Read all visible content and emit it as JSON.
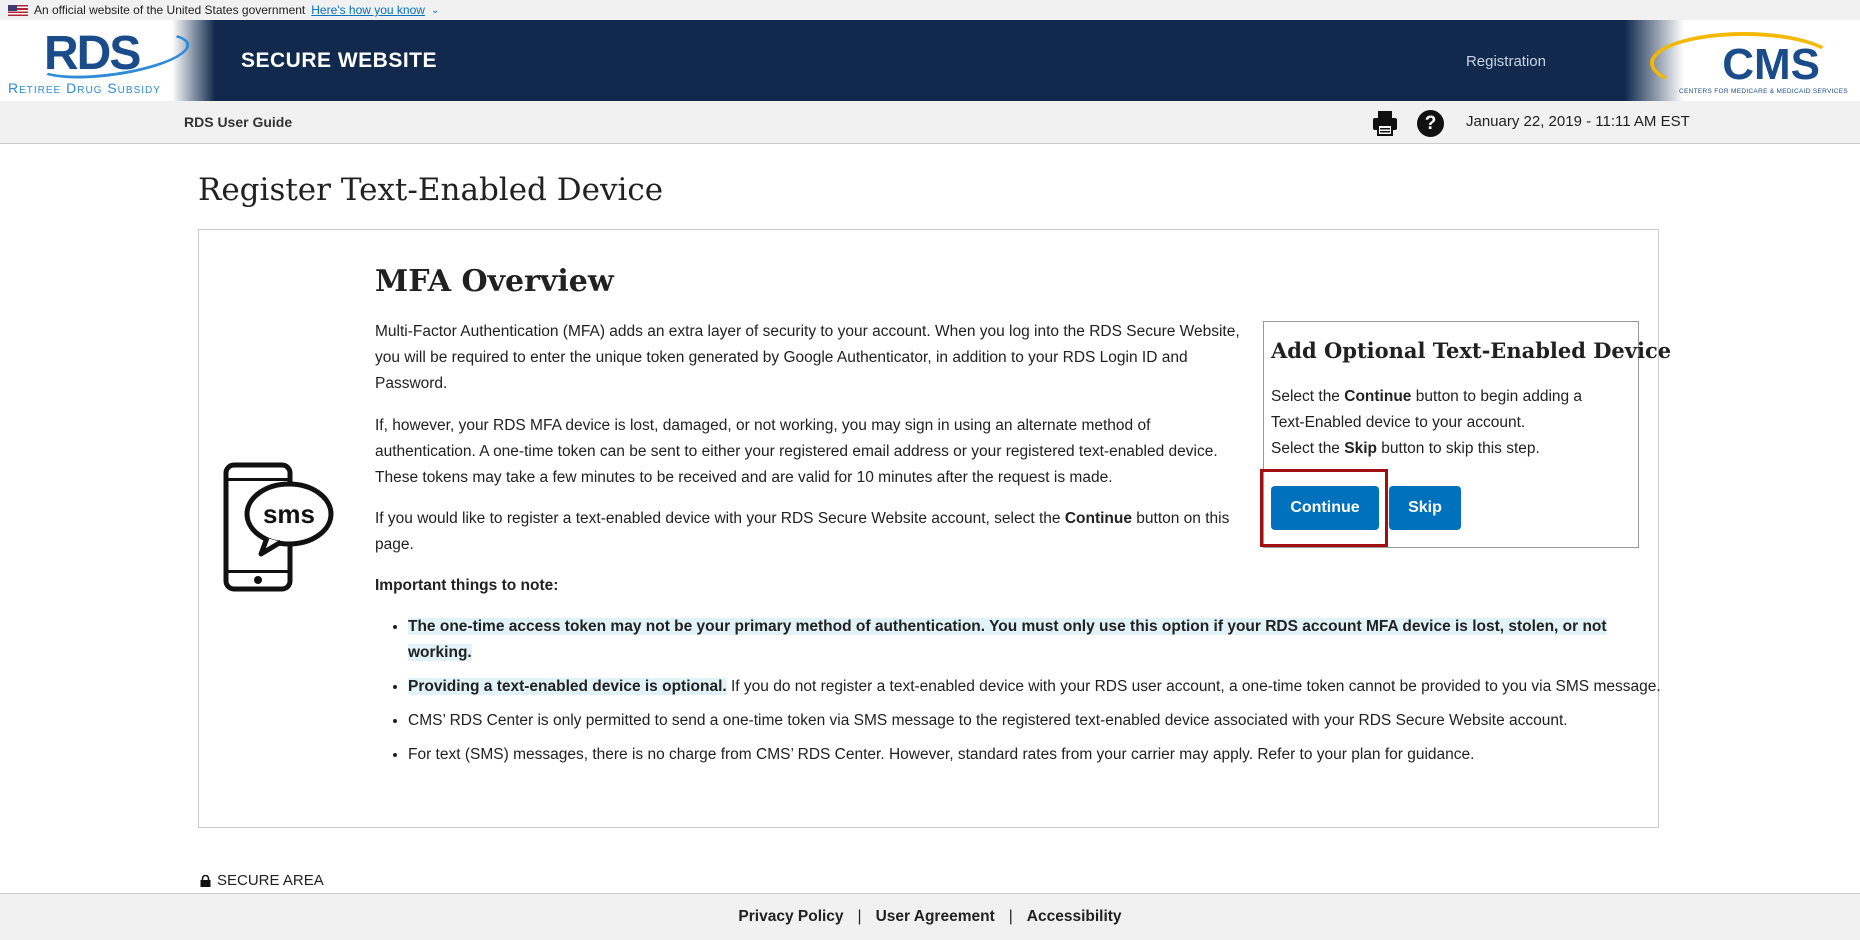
{
  "gov_banner": {
    "text": "An official website of the United States government",
    "link": "Here's how you know"
  },
  "header": {
    "logo_text": "RDS",
    "logo_subtitle": "Retiree Drug Subsidy",
    "site_title": "SECURE WEBSITE",
    "registration_link": "Registration",
    "cms_logo_text": "CMS",
    "cms_logo_subtitle": "CENTERS FOR MEDICARE & MEDICAID SERVICES"
  },
  "subnav": {
    "user_guide": "RDS User Guide",
    "help_glyph": "?",
    "datetime": "January 22, 2019 - 11:11 AM EST"
  },
  "page": {
    "title": "Register Text-Enabled Device"
  },
  "main": {
    "phone_label": "sms",
    "section_title": "MFA Overview",
    "paragraph1": "Multi-Factor Authentication (MFA) adds an extra layer of security to your account. When you log into the RDS Secure Website, you will be required to enter the unique token generated by Google Authenticator, in addition to your RDS Login ID and Password.",
    "paragraph2": "If, however, your RDS MFA device is lost, damaged, or not working, you may sign in using an alternate method of authentication. A one-time token can be sent to either your registered email address or your registered text-enabled device. These tokens may take a few minutes to be received and are valid for 10 minutes after the request is made.",
    "paragraph3_before": "If you would like to register a text-enabled device with your RDS Secure Website account, select the ",
    "paragraph3_bold": "Continue",
    "paragraph3_after": " button on this page.",
    "notes_heading": "Important things to note:",
    "bullet1": "The one-time access token may not be your primary method of authentication. You must only use this option if your RDS account MFA device is lost, stolen, or not working.",
    "bullet2_bold": "Providing a text-enabled device is optional.",
    "bullet2_rest": " If you do not register a text-enabled device with your RDS user account, a one-time token cannot be provided to you via SMS message.",
    "bullet3": "CMS’ RDS Center is only permitted to send a one-time token via SMS message to the registered text-enabled device associated with your RDS Secure Website account.",
    "bullet4": "For text (SMS) messages, there is no charge from CMS’ RDS Center. However, standard rates from your carrier may apply. Refer to your plan for guidance."
  },
  "side_panel": {
    "title": "Add Optional Text-Enabled Device",
    "line1_before": "Select the ",
    "line1_bold": "Continue",
    "line1_after": " button to begin adding a Text-Enabled device to your account.",
    "line2_before": "Select the ",
    "line2_bold": "Skip",
    "line2_after": " button to skip this step.",
    "continue_label": "Continue",
    "skip_label": "Skip"
  },
  "secure_area": "SECURE AREA",
  "footer": {
    "privacy": "Privacy Policy",
    "agreement": "User Agreement",
    "accessibility": "Accessibility",
    "separator": "|"
  },
  "colors": {
    "header_bg": "#10294d",
    "primary_button": "#0071bc",
    "highlight_bg": "#e1f3f8",
    "callout_border": "#a01010"
  }
}
